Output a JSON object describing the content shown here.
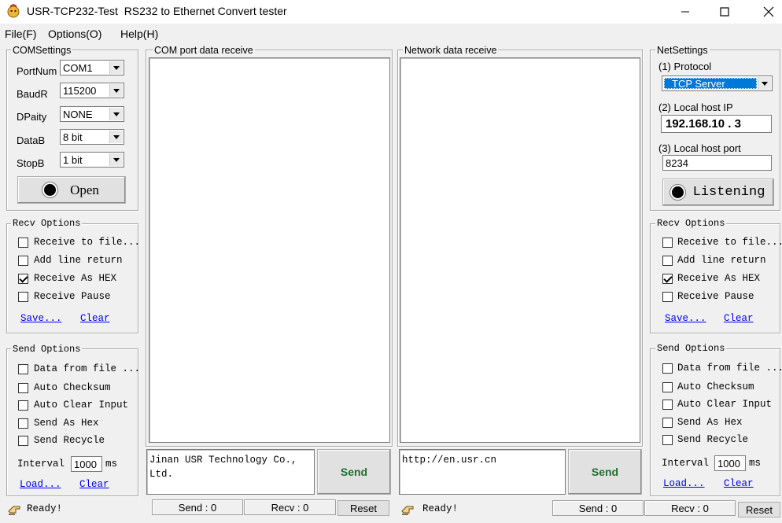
{
  "window": {
    "title": "USR-TCP232-Test  RS232 to Ethernet Convert tester",
    "minimize": "—",
    "maximize": "☐",
    "close": "✕"
  },
  "menu": [
    "File(F)",
    "Options(O)",
    "Help(H)"
  ],
  "com_settings": {
    "title": "COMSettings",
    "rows": [
      {
        "label": "PortNum",
        "value": "COM1"
      },
      {
        "label": "BaudR",
        "value": "115200"
      },
      {
        "label": "DPaity",
        "value": "NONE"
      },
      {
        "label": "DataB",
        "value": "8 bit"
      },
      {
        "label": "StopB",
        "value": "1 bit"
      }
    ],
    "open_button": "Open"
  },
  "left_recv": {
    "title": "Recv Options",
    "options": [
      {
        "label": "Receive to file...",
        "checked": false
      },
      {
        "label": "Add line return",
        "checked": false
      },
      {
        "label": "Receive As HEX",
        "checked": true
      },
      {
        "label": "Receive Pause",
        "checked": false
      }
    ],
    "save_link": "Save...",
    "clear_link": "Clear"
  },
  "left_send": {
    "title": "Send Options",
    "options": [
      {
        "label": "Data from file ...",
        "checked": false
      },
      {
        "label": "Auto Checksum",
        "checked": false
      },
      {
        "label": "Auto Clear Input",
        "checked": false
      },
      {
        "label": "Send As Hex",
        "checked": false
      },
      {
        "label": "Send Recycle",
        "checked": false
      }
    ],
    "interval_label": "Interval",
    "interval_value": "1000",
    "interval_unit": "ms",
    "load_link": "Load...",
    "clear_link": "Clear"
  },
  "com_receive": {
    "title": "COM port data receive"
  },
  "net_receive": {
    "title": "Network data receive"
  },
  "com_send": {
    "text_line1": "Jinan USR Technology Co.,",
    "text_line2": "Ltd.",
    "send_button": "Send"
  },
  "net_send": {
    "text": "http://en.usr.cn",
    "send_button": "Send"
  },
  "net_settings": {
    "title": "NetSettings",
    "protocol_label": "(1) Protocol",
    "protocol_value": "TCP Server",
    "ip_label": "(2) Local host IP",
    "ip_value": "192.168.10 . 3",
    "port_label": "(3) Local host port",
    "port_value": "8234",
    "listen_button": "Listening"
  },
  "right_recv": {
    "title": "Recv Options",
    "options": [
      {
        "label": "Receive to file...",
        "checked": false
      },
      {
        "label": "Add line return",
        "checked": false
      },
      {
        "label": "Receive As HEX",
        "checked": true
      },
      {
        "label": "Receive Pause",
        "checked": false
      }
    ],
    "save_link": "Save...",
    "clear_link": "Clear"
  },
  "right_send": {
    "title": "Send Options",
    "options": [
      {
        "label": "Data from file ...",
        "checked": false
      },
      {
        "label": "Auto Checksum",
        "checked": false
      },
      {
        "label": "Auto Clear Input",
        "checked": false
      },
      {
        "label": "Send As Hex",
        "checked": false
      },
      {
        "label": "Send Recycle",
        "checked": false
      }
    ],
    "interval_label": "Interval",
    "interval_value": "1000",
    "interval_unit": "ms",
    "load_link": "Load...",
    "clear_link": "Clear"
  },
  "status_left": {
    "ready": "Ready!",
    "send": "Send : 0",
    "recv": "Recv : 0",
    "reset": "Reset"
  },
  "status_right": {
    "ready": "Ready!",
    "send": "Send : 0",
    "recv": "Recv : 0",
    "reset": "Reset"
  },
  "colors": {
    "protocol_highlight": "#0078d7",
    "link": "#0000ee"
  }
}
